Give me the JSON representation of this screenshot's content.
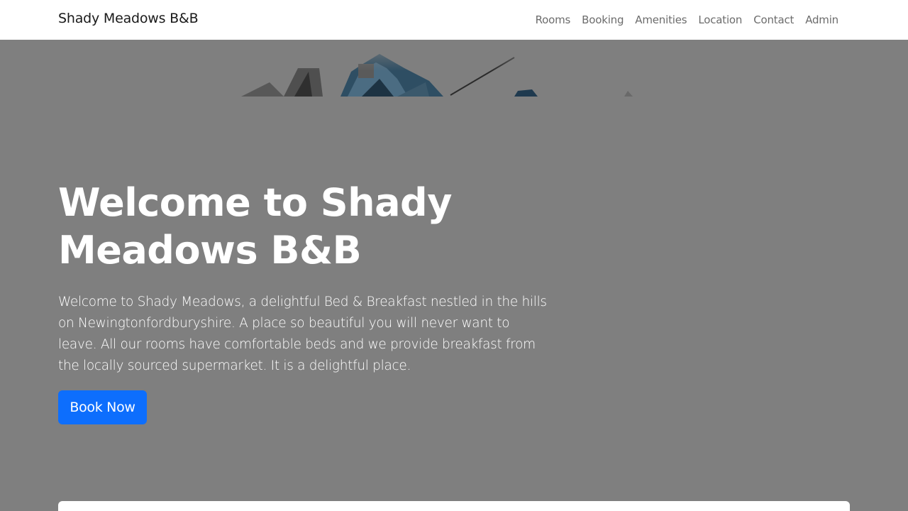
{
  "navbar": {
    "brand": "Shady Meadows B&B",
    "links": [
      {
        "label": "Rooms"
      },
      {
        "label": "Booking"
      },
      {
        "label": "Amenities"
      },
      {
        "label": "Location"
      },
      {
        "label": "Contact"
      },
      {
        "label": "Admin"
      }
    ]
  },
  "hero": {
    "title": "Welcome to Shady Meadows B&B",
    "description": "Welcome to Shady Meadows, a delightful Bed & Breakfast nestled in the hills on Newingtonfordburyshire. A place so beautiful you will never want to leave. All our rooms have comfortable beds and we provide breakfast from the locally sourced supermarket. It is a delightful place.",
    "cta_label": "Book Now"
  },
  "colors": {
    "overlay": "#7f7f7f",
    "primary": "#0d6efd",
    "navbar_bg": "#ffffff",
    "nav_link": "#6c6c6c"
  }
}
